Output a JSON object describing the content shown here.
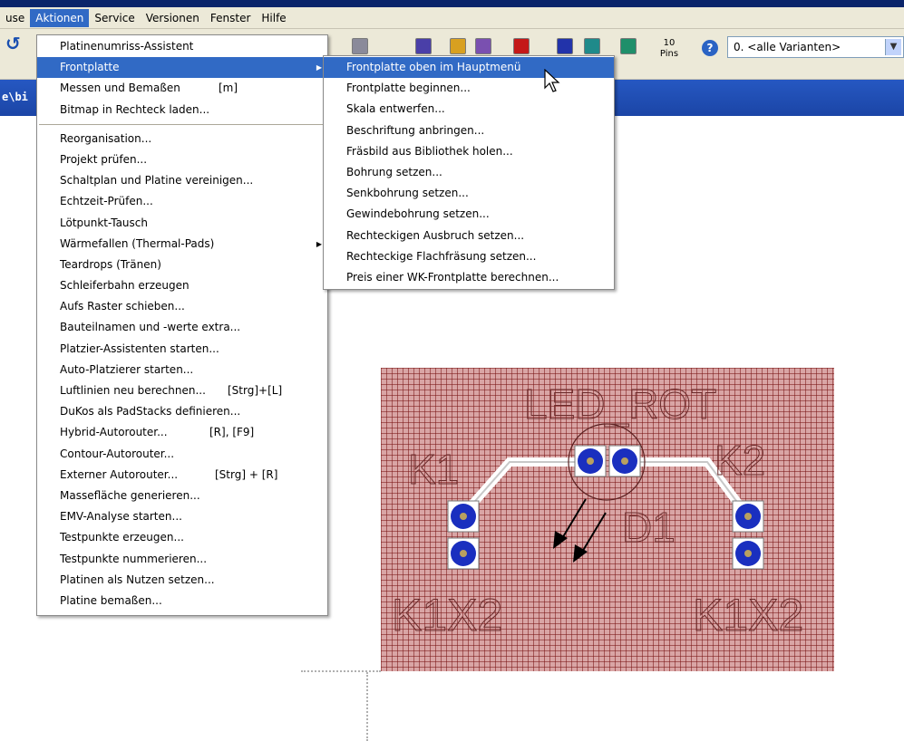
{
  "menubar": {
    "items": [
      {
        "label": "use"
      },
      {
        "label": "Aktionen"
      },
      {
        "label": "Service"
      },
      {
        "label": "Versionen"
      },
      {
        "label": "Fenster"
      },
      {
        "label": "Hilfe"
      }
    ]
  },
  "toolbar": {
    "pins_count": "10",
    "pins_label": "Pins",
    "variant_value": "0. <alle Varianten>"
  },
  "pathbar": {
    "text": "e\\bi"
  },
  "aktionen_menu": {
    "group1": [
      {
        "label": "Platinenumriss-Assistent"
      },
      {
        "label": "Frontplatte"
      },
      {
        "label": "Messen und Bemaßen",
        "shortcut": "[m]"
      },
      {
        "label": "Bitmap in Rechteck laden..."
      }
    ],
    "group2": [
      {
        "label": "Reorganisation..."
      },
      {
        "label": "Projekt prüfen..."
      },
      {
        "label": "Schaltplan und Platine vereinigen..."
      },
      {
        "label": "Echtzeit-Prüfen..."
      },
      {
        "label": "Lötpunkt-Tausch"
      },
      {
        "label": "Wärmefallen (Thermal-Pads)"
      },
      {
        "label": "Teardrops (Tränen)"
      },
      {
        "label": "Schleiferbahn erzeugen"
      },
      {
        "label": "Aufs Raster schieben..."
      },
      {
        "label": "Bauteilnamen und -werte extra..."
      },
      {
        "label": "Platzier-Assistenten starten..."
      },
      {
        "label": "Auto-Platzierer starten..."
      },
      {
        "label": "Luftlinien neu berechnen...",
        "shortcut": "[Strg]+[L]"
      },
      {
        "label": "DuKos als PadStacks definieren..."
      },
      {
        "label": "Hybrid-Autorouter...",
        "shortcut": "[R], [F9]"
      },
      {
        "label": "Contour-Autorouter..."
      },
      {
        "label": "Externer Autorouter...",
        "shortcut": "[Strg] + [R]"
      },
      {
        "label": "Massefläche generieren..."
      },
      {
        "label": "EMV-Analyse starten..."
      },
      {
        "label": "Testpunkte erzeugen..."
      },
      {
        "label": "Testpunkte nummerieren..."
      },
      {
        "label": "Platinen als Nutzen setzen..."
      },
      {
        "label": "Platine bemaßen..."
      }
    ]
  },
  "frontplatte_submenu": {
    "items": [
      {
        "label": "Frontplatte oben im Hauptmenü"
      },
      {
        "label": "Frontplatte beginnen..."
      },
      {
        "label": "Skala entwerfen..."
      },
      {
        "label": "Beschriftung anbringen..."
      },
      {
        "label": "Fräsbild aus Bibliothek holen..."
      },
      {
        "label": "Bohrung setzen..."
      },
      {
        "label": "Senkbohrung setzen..."
      },
      {
        "label": "Gewindebohrung setzen..."
      },
      {
        "label": "Rechteckigen Ausbruch setzen..."
      },
      {
        "label": "Rechteckige Flachfräsung setzen..."
      },
      {
        "label": "Preis einer WK-Frontplatte berechnen..."
      }
    ]
  },
  "board": {
    "labels": {
      "led": "LED_ROT",
      "k1": "K1",
      "k2": "K2",
      "d1": "D1",
      "k1x2_left": "K1X2",
      "k1x2_right": "K1X2"
    }
  },
  "colors": {
    "menu_highlight": "#316ac5",
    "board_fill": "#d9a5a5",
    "pad_blue": "#1a2fbf"
  }
}
